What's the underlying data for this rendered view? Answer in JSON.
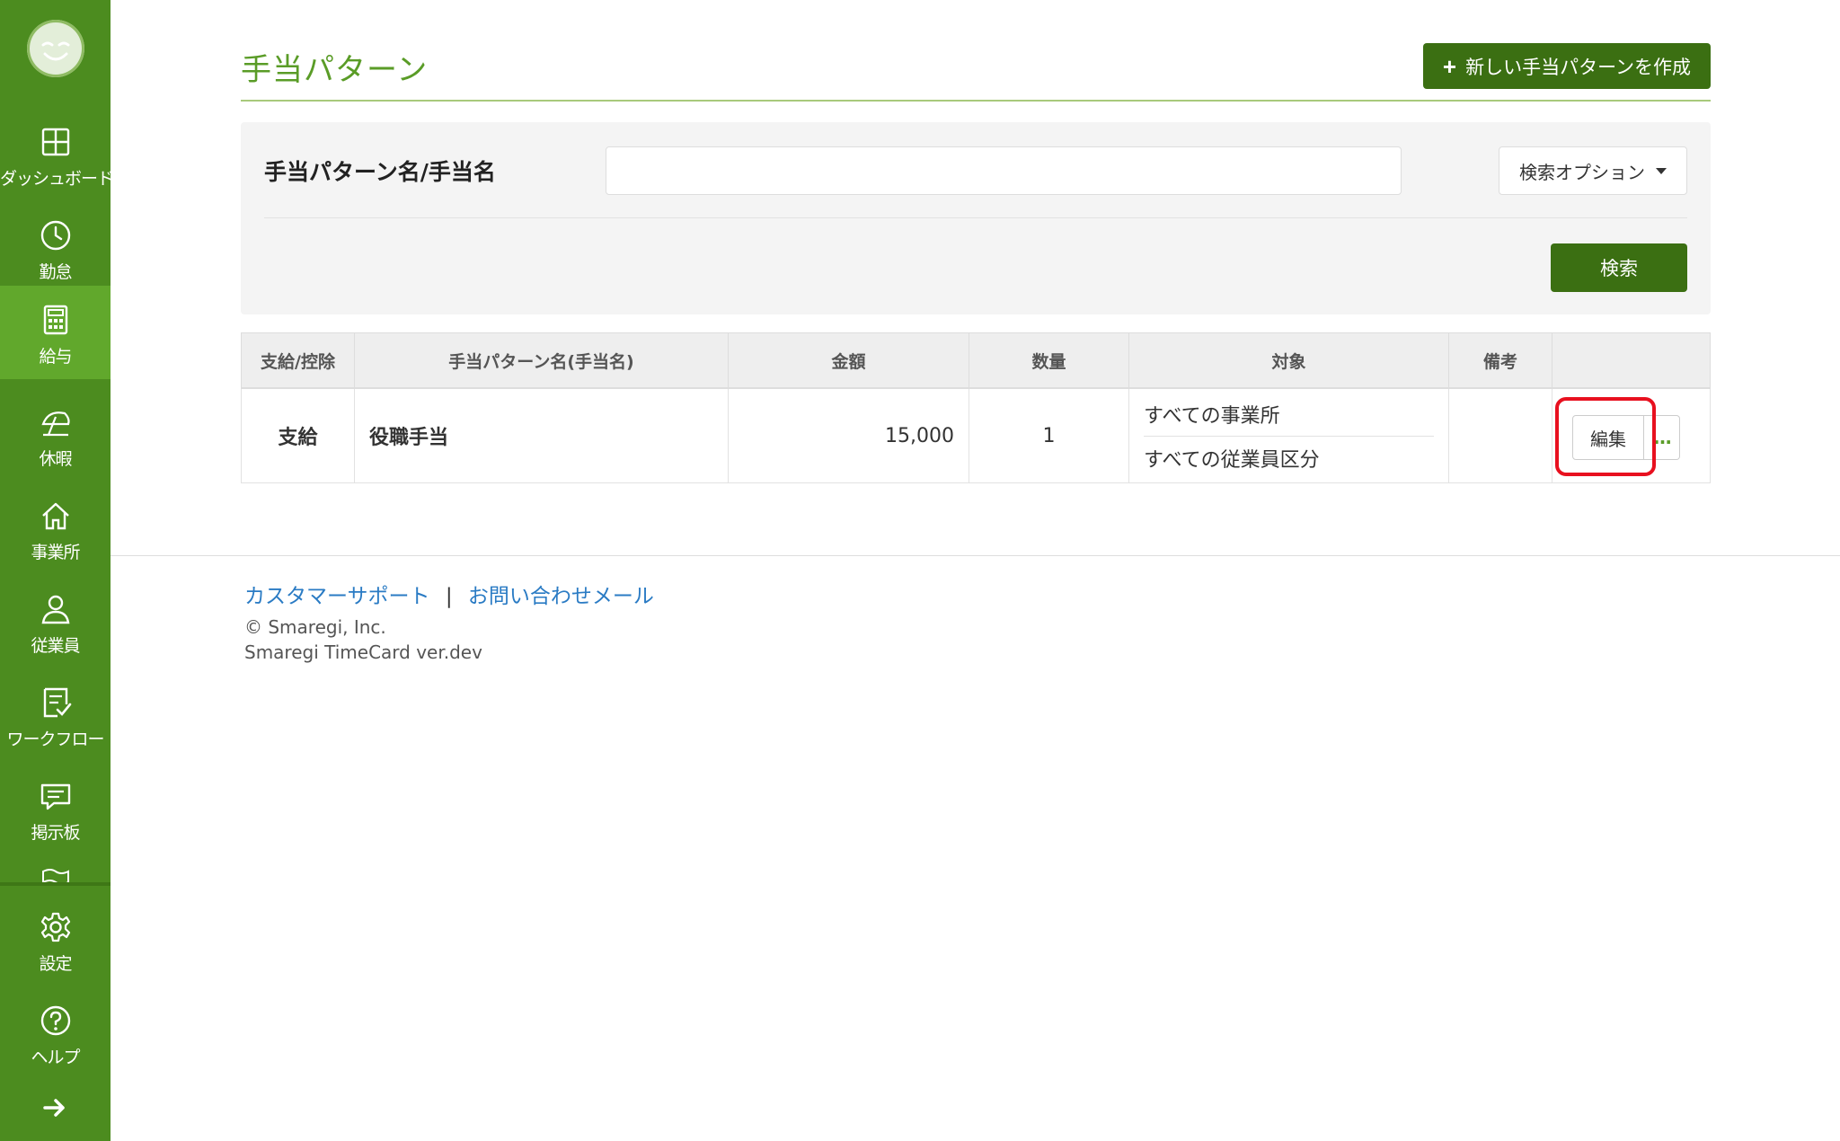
{
  "sidebar": {
    "items": [
      {
        "label": "ダッシュボード",
        "icon": "dashboard-icon"
      },
      {
        "label": "勤怠",
        "icon": "clock-icon"
      },
      {
        "label": "給与",
        "icon": "calculator-icon"
      },
      {
        "label": "休暇",
        "icon": "umbrella-icon"
      },
      {
        "label": "事業所",
        "icon": "home-icon"
      },
      {
        "label": "従業員",
        "icon": "person-icon"
      },
      {
        "label": "ワークフロー",
        "icon": "checklist-icon"
      },
      {
        "label": "掲示板",
        "icon": "message-icon"
      },
      {
        "label": "設定",
        "icon": "gear-icon"
      },
      {
        "label": "ヘルプ",
        "icon": "help-icon"
      }
    ],
    "active": "給与"
  },
  "header": {
    "title": "手当パターン",
    "create_label": "新しい手当パターンを作成"
  },
  "search": {
    "label": "手当パターン名/手当名",
    "input_value": "",
    "option_label": "検索オプション",
    "button_label": "検索"
  },
  "table": {
    "columns": [
      "支給/控除",
      "手当パターン名(手当名)",
      "金額",
      "数量",
      "対象",
      "備考",
      ""
    ],
    "rows": [
      {
        "type": "支給",
        "name": "役職手当",
        "amount": "15,000",
        "quantity": "1",
        "target_office": "すべての事業所",
        "target_employee": "すべての従業員区分",
        "note": "",
        "edit_label": "編集",
        "more_label": "…"
      }
    ]
  },
  "footer": {
    "link_support": "カスタマーサポート",
    "link_sep": "|",
    "link_mail": "お問い合わせメール",
    "copyright": "© Smaregi, Inc.",
    "version": "Smaregi TimeCard ver.dev"
  },
  "colors": {
    "sidebar": "#4c8c1f",
    "sidebar_active": "#61a82c",
    "accent_dark": "#3b6f12",
    "title": "#5a9c27",
    "highlight": "#e8101f",
    "link": "#2a7bc4"
  }
}
